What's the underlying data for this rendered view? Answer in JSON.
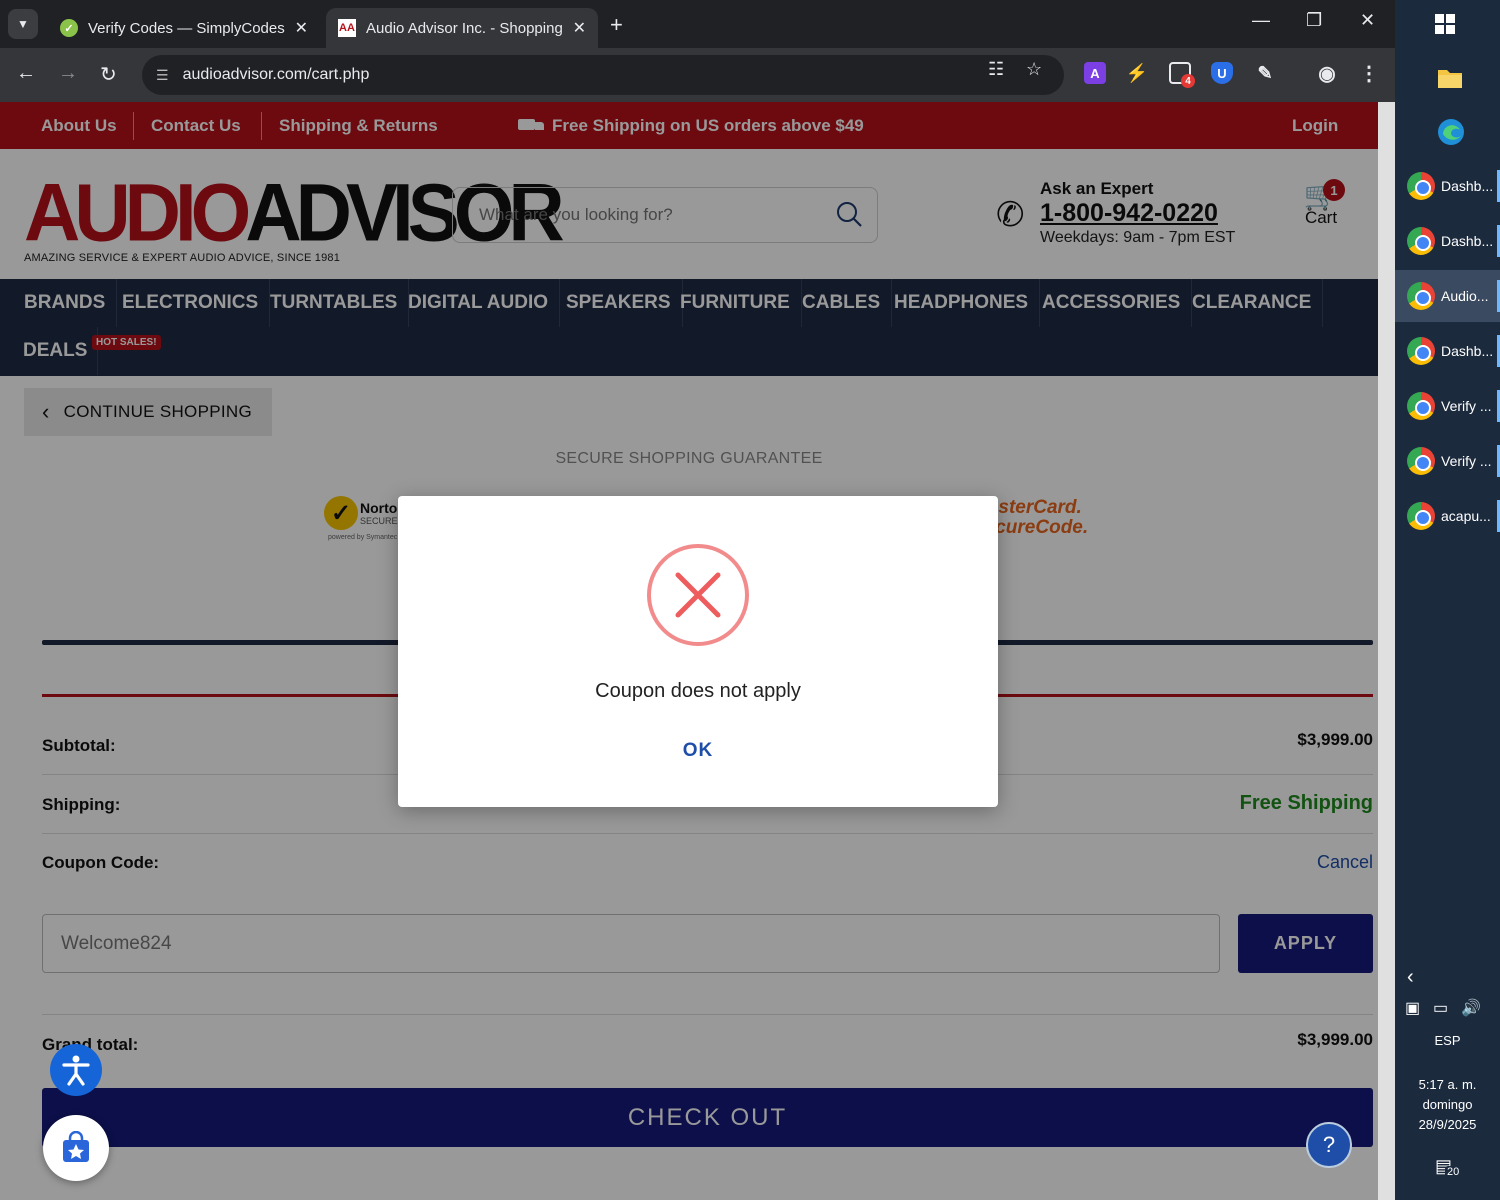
{
  "browser": {
    "tabs": [
      {
        "title": "Verify Codes — SimplyCodes",
        "active": false
      },
      {
        "title": "Audio Advisor Inc. - Shopping C",
        "active": true
      }
    ],
    "url": "audioadvisor.com/cart.php",
    "extension_badge": "4"
  },
  "topbar": {
    "links": [
      "About Us",
      "Contact Us",
      "Shipping & Returns"
    ],
    "promo": "Free Shipping on US orders above $49",
    "login": "Login"
  },
  "header": {
    "logo_audio": "AUDIO",
    "logo_advisor": "ADVISOR",
    "logo_tagline": "AMAZING SERVICE & EXPERT AUDIO ADVICE, SINCE 1981",
    "search_placeholder": "What are you looking for?",
    "expert_title": "Ask an Expert",
    "expert_phone": "1-800-942-0220",
    "expert_hours": "Weekdays: 9am - 7pm EST",
    "cart_label": "Cart",
    "cart_count": "1"
  },
  "nav": {
    "items": [
      "BRANDS",
      "ELECTRONICS",
      "TURNTABLES",
      "DIGITAL AUDIO",
      "SPEAKERS",
      "FURNITURE",
      "CABLES",
      "HEADPHONES",
      "ACCESSORIES",
      "CLEARANCE",
      "DEALS"
    ],
    "hot_badge": "HOT SALES!"
  },
  "cart_page": {
    "continue_label": "CONTINUE SHOPPING",
    "secure_title": "SECURE SHOPPING GUARANTEE",
    "norton_name": "Norton",
    "norton_sub": "SECURED",
    "norton_powered": "powered by Symantec",
    "mastercard_line1": "MasterCard.",
    "mastercard_line2": "SecureCode.",
    "subtotal_label": "Subtotal:",
    "subtotal_value": "$3,999.00",
    "shipping_label": "Shipping:",
    "shipping_value": "Free Shipping",
    "coupon_label": "Coupon Code:",
    "coupon_cancel": "Cancel",
    "coupon_value": "Welcome824",
    "apply_label": "APPLY",
    "grand_label": "Grand total:",
    "grand_value": "$3,999.00",
    "checkout_label": "CHECK OUT"
  },
  "dialog": {
    "message": "Coupon does not apply",
    "ok_label": "OK"
  },
  "taskbar": {
    "items": [
      {
        "label": "Dashb...",
        "active": false
      },
      {
        "label": "Dashb...",
        "active": false
      },
      {
        "label": "Audio...",
        "active": true
      },
      {
        "label": "Dashb...",
        "active": false
      },
      {
        "label": "Verify ...",
        "active": false
      },
      {
        "label": "Verify ...",
        "active": false
      },
      {
        "label": "acapu...",
        "active": false
      }
    ],
    "language": "ESP",
    "time": "5:17 a. m.",
    "day": "domingo",
    "date": "28/9/2025",
    "notification_count": "20"
  },
  "colors": {
    "brand_red": "#b5121b",
    "nav_navy": "#1e2a44",
    "button_blue": "#141a7a",
    "free_shipping_green": "#1e8a1e"
  }
}
